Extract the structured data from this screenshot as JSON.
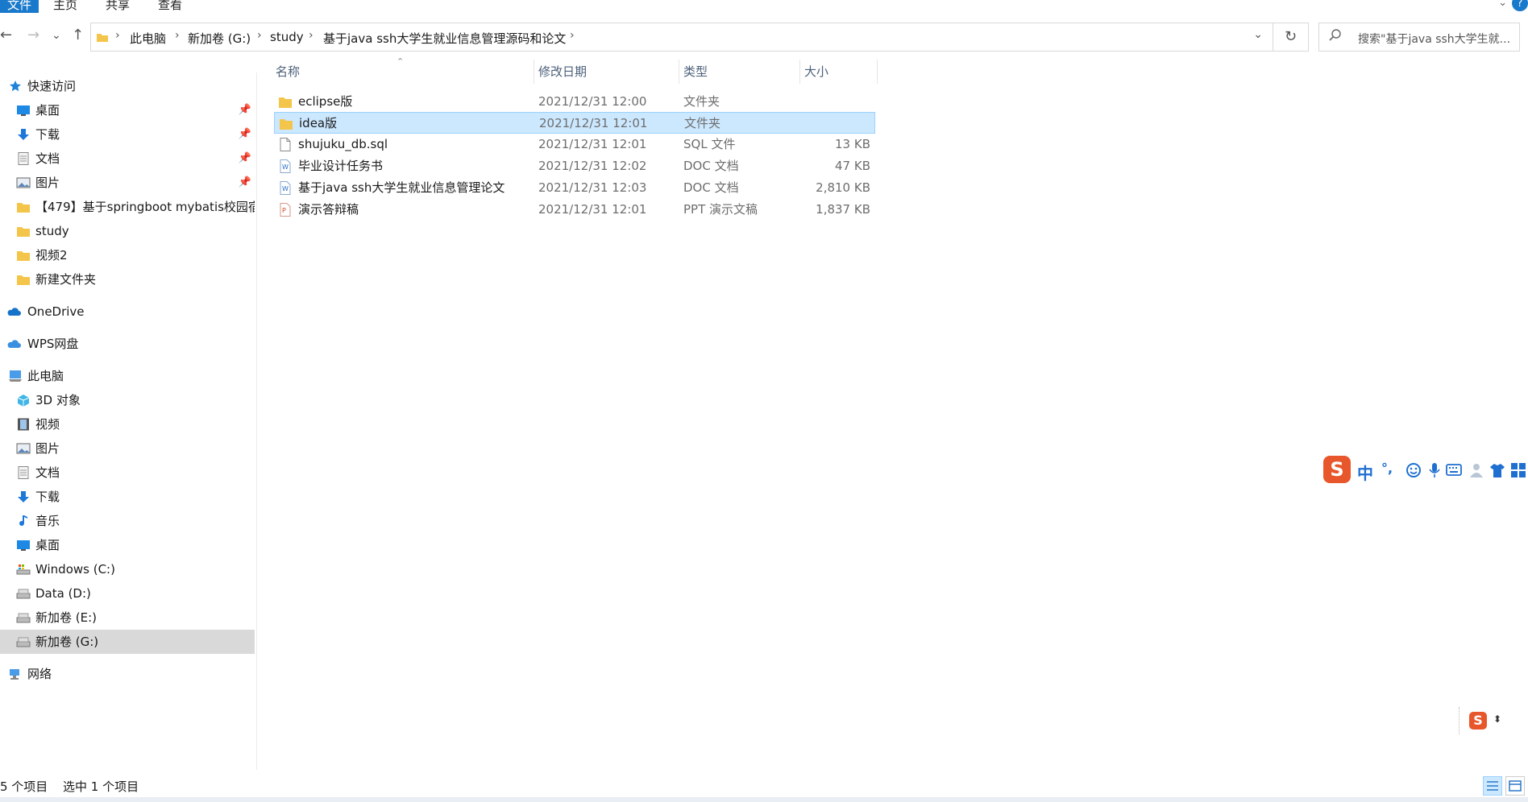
{
  "ribbon": {
    "tabs": [
      "文件",
      "主页",
      "共享",
      "查看"
    ],
    "help": "?"
  },
  "nav": {
    "back": "←",
    "forward": "→",
    "recent": "⌄",
    "up": "↑",
    "breadcrumbs": [
      "此电脑",
      "新加卷 (G:)",
      "study",
      "基于java ssh大学生就业信息管理源码和论文"
    ],
    "refresh": "↻",
    "search_placeholder": "搜索\"基于java ssh大学生就..."
  },
  "sidebar": {
    "quick_access": "快速访问",
    "quick_items": [
      {
        "label": "桌面",
        "icon": "desktop-icon",
        "pinned": true
      },
      {
        "label": "下载",
        "icon": "download-icon",
        "pinned": true
      },
      {
        "label": "文档",
        "icon": "document-icon",
        "pinned": true
      },
      {
        "label": "图片",
        "icon": "picture-icon",
        "pinned": true
      },
      {
        "label": "【479】基于springboot mybatis校园宿",
        "icon": "folder-icon",
        "pinned": false
      },
      {
        "label": "study",
        "icon": "folder-icon",
        "pinned": false
      },
      {
        "label": "视频2",
        "icon": "folder-icon",
        "pinned": false
      },
      {
        "label": "新建文件夹",
        "icon": "folder-icon",
        "pinned": false
      }
    ],
    "onedrive": "OneDrive",
    "wps": "WPS网盘",
    "this_pc": "此电脑",
    "pc_items": [
      {
        "label": "3D 对象",
        "icon": "3d-objects-icon"
      },
      {
        "label": "视频",
        "icon": "video-icon"
      },
      {
        "label": "图片",
        "icon": "picture-icon"
      },
      {
        "label": "文档",
        "icon": "document-icon"
      },
      {
        "label": "下载",
        "icon": "download-icon"
      },
      {
        "label": "音乐",
        "icon": "music-icon"
      },
      {
        "label": "桌面",
        "icon": "desktop-icon"
      },
      {
        "label": "Windows (C:)",
        "icon": "drive-icon"
      },
      {
        "label": "Data (D:)",
        "icon": "drive-icon"
      },
      {
        "label": "新加卷 (E:)",
        "icon": "drive-icon"
      },
      {
        "label": "新加卷 (G:)",
        "icon": "drive-icon",
        "selected": true
      }
    ],
    "network": "网络"
  },
  "columns": {
    "name": "名称",
    "date": "修改日期",
    "type": "类型",
    "size": "大小"
  },
  "files": [
    {
      "name": "eclipse版",
      "date": "2021/12/31 12:00",
      "type": "文件夹",
      "size": "",
      "icon": "folder-icon"
    },
    {
      "name": "idea版",
      "date": "2021/12/31 12:01",
      "type": "文件夹",
      "size": "",
      "icon": "folder-icon",
      "selected": true
    },
    {
      "name": "shujuku_db.sql",
      "date": "2021/12/31 12:01",
      "type": "SQL 文件",
      "size": "13 KB",
      "icon": "file-icon"
    },
    {
      "name": "毕业设计任务书",
      "date": "2021/12/31 12:02",
      "type": "DOC 文档",
      "size": "47 KB",
      "icon": "doc-icon"
    },
    {
      "name": "基于java ssh大学生就业信息管理论文",
      "date": "2021/12/31 12:03",
      "type": "DOC 文档",
      "size": "2,810 KB",
      "icon": "doc-icon"
    },
    {
      "name": "演示答辩稿",
      "date": "2021/12/31 12:01",
      "type": "PPT 演示文稿",
      "size": "1,837 KB",
      "icon": "ppt-icon"
    }
  ],
  "status": {
    "count": "5 个项目",
    "selected": "选中 1 个项目"
  },
  "ime": {
    "logo": "S",
    "lang": "中",
    "punct": "°,"
  },
  "colors": {
    "selection": "#cce8ff",
    "selection_border": "#99d1ff",
    "accent": "#1979ca",
    "header_text": "#4c607a"
  }
}
